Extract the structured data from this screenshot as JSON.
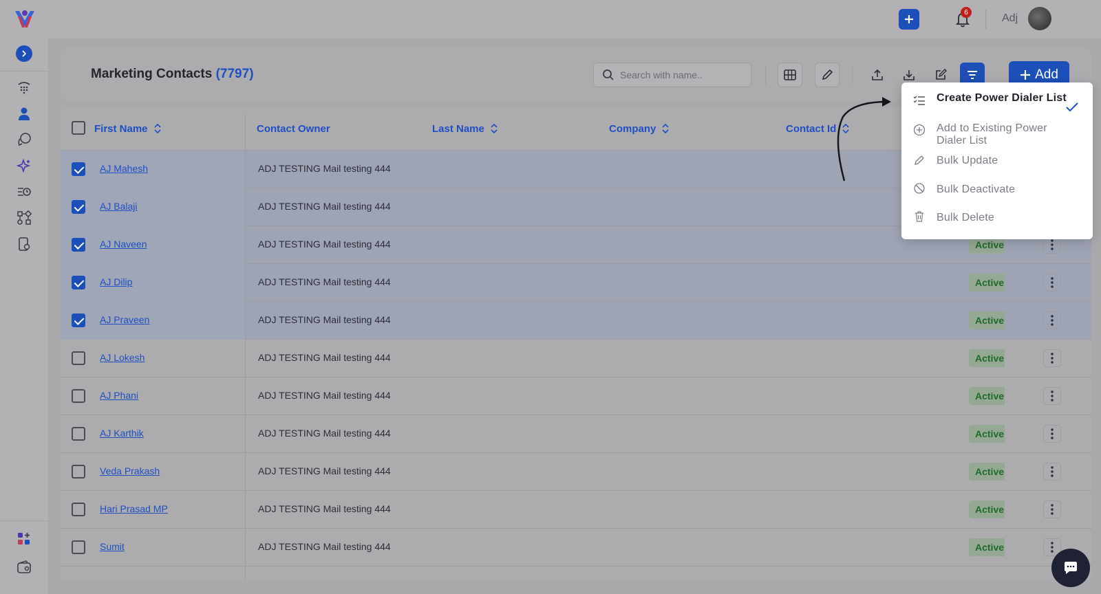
{
  "topbar": {
    "notification_count": "6",
    "user_name": "Adj"
  },
  "header": {
    "title": "Marketing Contacts",
    "count": "(7797)",
    "search_placeholder": "Search with name..",
    "add_label": "Add"
  },
  "table": {
    "columns": [
      "First Name",
      "Contact Owner",
      "Last Name",
      "Company",
      "Contact Id"
    ],
    "rows": [
      {
        "name": "AJ Mahesh",
        "owner": "ADJ TESTING Mail testing 444",
        "status": "",
        "selected": true
      },
      {
        "name": "AJ Balaji",
        "owner": "ADJ TESTING Mail testing 444",
        "status": "",
        "selected": true
      },
      {
        "name": "AJ Naveen",
        "owner": "ADJ TESTING Mail testing 444",
        "status": "Active",
        "selected": true
      },
      {
        "name": "AJ Dilip",
        "owner": "ADJ TESTING Mail testing 444",
        "status": "Active",
        "selected": true
      },
      {
        "name": "AJ Praveen",
        "owner": "ADJ TESTING Mail testing 444",
        "status": "Active",
        "selected": true
      },
      {
        "name": "AJ Lokesh",
        "owner": "ADJ TESTING Mail testing 444",
        "status": "Active",
        "selected": false
      },
      {
        "name": "AJ Phani",
        "owner": "ADJ TESTING Mail testing 444",
        "status": "Active",
        "selected": false
      },
      {
        "name": "AJ Karthik",
        "owner": "ADJ TESTING Mail testing 444",
        "status": "Active",
        "selected": false
      },
      {
        "name": "Veda Prakash",
        "owner": "ADJ TESTING Mail testing 444",
        "status": "Active",
        "selected": false
      },
      {
        "name": "Hari Prasad MP",
        "owner": "ADJ TESTING Mail testing 444",
        "status": "Active",
        "selected": false
      },
      {
        "name": "Sumit",
        "owner": "ADJ TESTING Mail testing 444",
        "status": "Active",
        "selected": false
      }
    ]
  },
  "bulk_menu": {
    "items": [
      {
        "label": "Create Power Dialer List",
        "icon": "list-check-icon",
        "active": true
      },
      {
        "label": "Add to Existing Power Dialer List",
        "icon": "plus-circle-icon",
        "active": false
      },
      {
        "label": "Bulk Update",
        "icon": "pencil-icon",
        "active": false
      },
      {
        "label": "Bulk Deactivate",
        "icon": "ban-icon",
        "active": false
      },
      {
        "label": "Bulk Delete",
        "icon": "trash-icon",
        "active": false
      }
    ]
  },
  "colors": {
    "accent": "#1d4fb8",
    "status_active": "#1f6b2a",
    "badge": "#c0201a"
  }
}
